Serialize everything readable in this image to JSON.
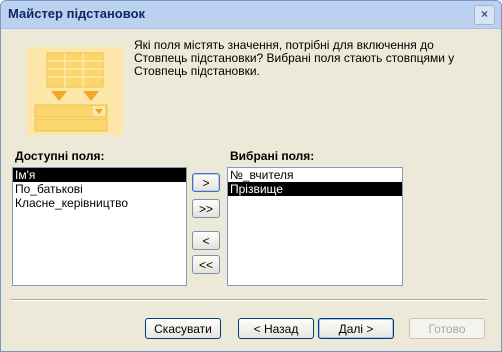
{
  "window": {
    "title": "Майстер підстановок",
    "close_glyph": "×"
  },
  "prompt": "Які поля містять значення, потрібні для включення до Стовпець підстановки? Вибрані поля стають стовпцями у Стовпець підстановки.",
  "available": {
    "label": "Доступні поля:",
    "items": [
      "Ім'я",
      "По_батькові",
      "Класне_керівництво"
    ],
    "selected_index": 0
  },
  "selected": {
    "label": "Вибрані поля:",
    "items": [
      "№_вчителя",
      "Прізвище"
    ],
    "selected_index": 1
  },
  "move_buttons": {
    "add": ">",
    "add_all": ">>",
    "remove": "<",
    "remove_all": "<<"
  },
  "footer": {
    "cancel": "Скасувати",
    "back": "< Назад",
    "next": "Далі >",
    "finish": "Готово"
  },
  "colors": {
    "illustration_bg": "#fde7a8",
    "illustration_accent": "#f5a623",
    "selection": "#000000"
  }
}
